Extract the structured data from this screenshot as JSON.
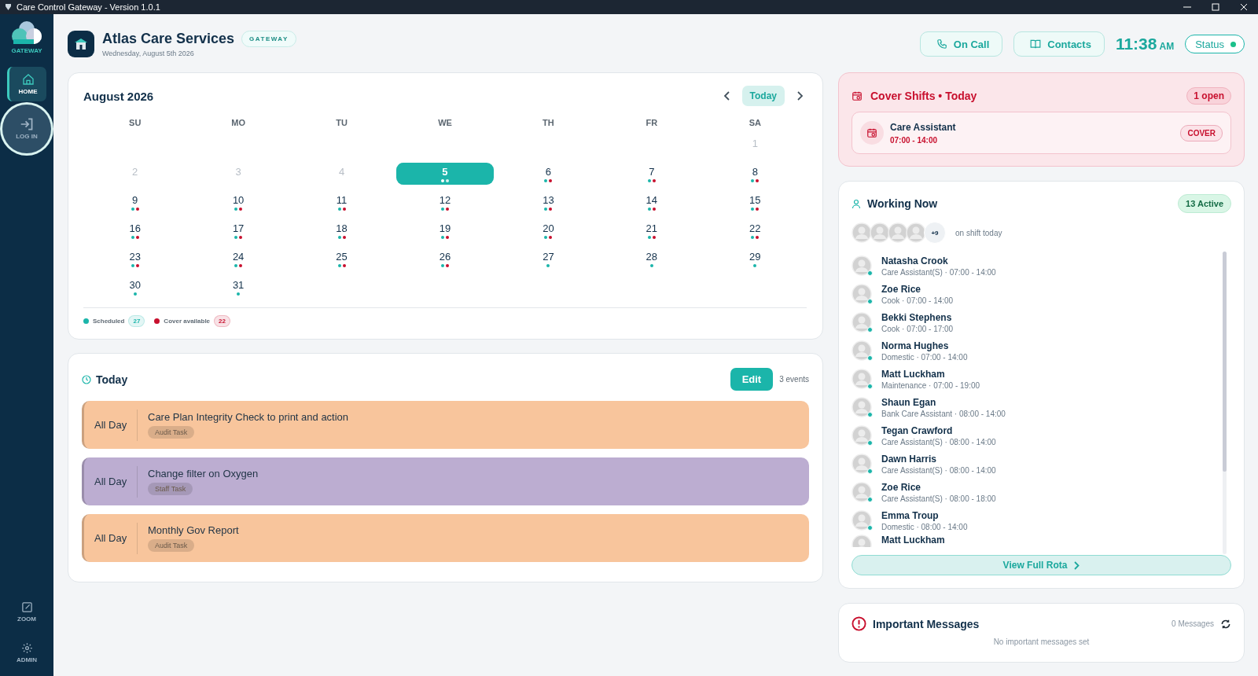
{
  "window": {
    "title": "Care Control Gateway - Version 1.0.1"
  },
  "sidebar": {
    "logo_label": "GATEWAY",
    "items": [
      {
        "label": "HOME",
        "selected": true,
        "focused": false
      },
      {
        "label": "LOG IN",
        "selected": false,
        "focused": true
      }
    ],
    "bottom_items": [
      {
        "label": "ZOOM",
        "selected": false,
        "focused": false
      },
      {
        "label": "ADMIN",
        "selected": false,
        "focused": false
      }
    ]
  },
  "header": {
    "title": "Atlas Care Services",
    "badge": "GATEWAY",
    "date": "Wednesday, August 5th 2026",
    "buttons": [
      {
        "label": "On Call"
      },
      {
        "label": "Contacts"
      }
    ],
    "time": "11:38",
    "ampm": "AM",
    "status": {
      "label": "Status",
      "on": true
    }
  },
  "calendar": {
    "title": "August 2026",
    "today_button": "Today",
    "weekdays": [
      "SU",
      "MO",
      "TU",
      "WE",
      "TH",
      "FR",
      "SA"
    ],
    "weeks": [
      [
        {
          "kind": "blank"
        },
        {
          "kind": "blank"
        },
        {
          "kind": "blank"
        },
        {
          "kind": "blank"
        },
        {
          "kind": "blank"
        },
        {
          "kind": "blank"
        },
        {
          "kind": "day",
          "day": "1",
          "muted": true,
          "selected": false,
          "scheduled": false,
          "cover": false
        }
      ],
      [
        {
          "kind": "day",
          "day": "2",
          "muted": true,
          "selected": false,
          "scheduled": false,
          "cover": false
        },
        {
          "kind": "day",
          "day": "3",
          "muted": true,
          "selected": false,
          "scheduled": false,
          "cover": false
        },
        {
          "kind": "day",
          "day": "4",
          "muted": true,
          "selected": false,
          "scheduled": false,
          "cover": false
        },
        {
          "kind": "day",
          "day": "5",
          "muted": false,
          "selected": true,
          "scheduled": true,
          "cover": true
        },
        {
          "kind": "day",
          "day": "6",
          "muted": false,
          "selected": false,
          "scheduled": true,
          "cover": true
        },
        {
          "kind": "day",
          "day": "7",
          "muted": false,
          "selected": false,
          "scheduled": true,
          "cover": true
        },
        {
          "kind": "day",
          "day": "8",
          "muted": false,
          "selected": false,
          "scheduled": true,
          "cover": true
        }
      ],
      [
        {
          "kind": "day",
          "day": "9",
          "muted": false,
          "selected": false,
          "scheduled": true,
          "cover": true
        },
        {
          "kind": "day",
          "day": "10",
          "muted": false,
          "selected": false,
          "scheduled": true,
          "cover": true
        },
        {
          "kind": "day",
          "day": "11",
          "muted": false,
          "selected": false,
          "scheduled": true,
          "cover": true
        },
        {
          "kind": "day",
          "day": "12",
          "muted": false,
          "selected": false,
          "scheduled": true,
          "cover": true
        },
        {
          "kind": "day",
          "day": "13",
          "muted": false,
          "selected": false,
          "scheduled": true,
          "cover": true
        },
        {
          "kind": "day",
          "day": "14",
          "muted": false,
          "selected": false,
          "scheduled": true,
          "cover": true
        },
        {
          "kind": "day",
          "day": "15",
          "muted": false,
          "selected": false,
          "scheduled": true,
          "cover": true
        }
      ],
      [
        {
          "kind": "day",
          "day": "16",
          "muted": false,
          "selected": false,
          "scheduled": true,
          "cover": true
        },
        {
          "kind": "day",
          "day": "17",
          "muted": false,
          "selected": false,
          "scheduled": true,
          "cover": true
        },
        {
          "kind": "day",
          "day": "18",
          "muted": false,
          "selected": false,
          "scheduled": true,
          "cover": true
        },
        {
          "kind": "day",
          "day": "19",
          "muted": false,
          "selected": false,
          "scheduled": true,
          "cover": true
        },
        {
          "kind": "day",
          "day": "20",
          "muted": false,
          "selected": false,
          "scheduled": true,
          "cover": true
        },
        {
          "kind": "day",
          "day": "21",
          "muted": false,
          "selected": false,
          "scheduled": true,
          "cover": true
        },
        {
          "kind": "day",
          "day": "22",
          "muted": false,
          "selected": false,
          "scheduled": true,
          "cover": true
        }
      ],
      [
        {
          "kind": "day",
          "day": "23",
          "muted": false,
          "selected": false,
          "scheduled": true,
          "cover": true
        },
        {
          "kind": "day",
          "day": "24",
          "muted": false,
          "selected": false,
          "scheduled": true,
          "cover": true
        },
        {
          "kind": "day",
          "day": "25",
          "muted": false,
          "selected": false,
          "scheduled": true,
          "cover": true
        },
        {
          "kind": "day",
          "day": "26",
          "muted": false,
          "selected": false,
          "scheduled": true,
          "cover": true
        },
        {
          "kind": "day",
          "day": "27",
          "muted": false,
          "selected": false,
          "scheduled": true,
          "cover": false
        },
        {
          "kind": "day",
          "day": "28",
          "muted": false,
          "selected": false,
          "scheduled": true,
          "cover": false
        },
        {
          "kind": "day",
          "day": "29",
          "muted": false,
          "selected": false,
          "scheduled": true,
          "cover": false
        }
      ],
      [
        {
          "kind": "day",
          "day": "30",
          "muted": false,
          "selected": false,
          "scheduled": true,
          "cover": false
        },
        {
          "kind": "day",
          "day": "31",
          "muted": false,
          "selected": false,
          "scheduled": true,
          "cover": false
        }
      ]
    ],
    "legend": [
      {
        "label": "Scheduled",
        "count": "27",
        "color": "#1bb5aa"
      },
      {
        "label": "Cover available",
        "count": "22",
        "color": "#c8102e"
      }
    ]
  },
  "today": {
    "title": "Today",
    "edit_button": "Edit",
    "count": "3 events",
    "events": [
      {
        "time": "All Day",
        "title": "Care Plan Integrity Check to print and action",
        "tag": "Audit Task",
        "color": "#f8c59c"
      },
      {
        "time": "All Day",
        "title": "Change filter on Oxygen",
        "tag": "Staff Task",
        "color": "#bcadd1"
      },
      {
        "time": "All Day",
        "title": "Monthly Gov Report",
        "tag": "Audit Task",
        "color": "#f8c59c"
      }
    ]
  },
  "cover_shifts": {
    "title": "Cover Shifts • Today",
    "badge": "1 open",
    "shifts": [
      {
        "role": "Care Assistant",
        "time": "07:00 - 14:00",
        "tag": "COVER"
      }
    ]
  },
  "working_now": {
    "title": "Working Now",
    "badge": "13 Active",
    "more": "+9",
    "note": "on shift today",
    "staff": [
      {
        "name": "Natasha Crook",
        "detail": "Care Assistant(S) · 07:00 - 14:00",
        "online": true
      },
      {
        "name": "Zoe Rice",
        "detail": "Cook · 07:00 - 14:00",
        "online": true
      },
      {
        "name": "Bekki Stephens",
        "detail": "Cook · 07:00 - 17:00",
        "online": true
      },
      {
        "name": "Norma Hughes",
        "detail": "Domestic · 07:00 - 14:00",
        "online": true
      },
      {
        "name": "Matt Luckham",
        "detail": "Maintenance · 07:00 - 19:00",
        "online": true
      },
      {
        "name": "Shaun Egan",
        "detail": "Bank Care Assistant · 08:00 - 14:00",
        "online": true
      },
      {
        "name": "Tegan Crawford",
        "detail": "Care Assistant(S) · 08:00 - 14:00",
        "online": true
      },
      {
        "name": "Dawn Harris",
        "detail": "Care Assistant(S) · 08:00 - 14:00",
        "online": true
      },
      {
        "name": "Zoe Rice",
        "detail": "Care Assistant(S) · 08:00 - 18:00",
        "online": true
      },
      {
        "name": "Emma Troup",
        "detail": "Domestic · 08:00 - 14:00",
        "online": true
      },
      {
        "name": "Matt Luckham"
      }
    ],
    "button": "View Full Rota"
  },
  "messages": {
    "title": "Important Messages",
    "count": "0 Messages",
    "empty": "No important messages set"
  }
}
